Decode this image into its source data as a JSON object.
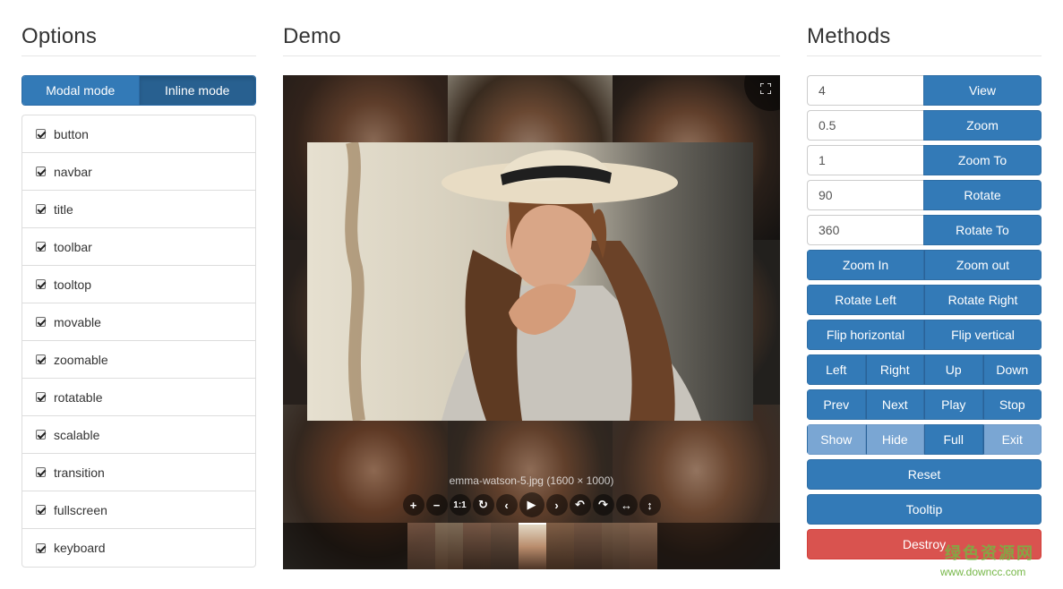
{
  "options": {
    "title": "Options",
    "modes": [
      "Modal mode",
      "Inline mode"
    ],
    "active_mode": "Inline mode",
    "items": [
      "button",
      "navbar",
      "title",
      "toolbar",
      "tooltop",
      "movable",
      "zoomable",
      "rotatable",
      "scalable",
      "transition",
      "fullscreen",
      "keyboard"
    ]
  },
  "demo": {
    "title": "Demo",
    "image_title": "emma-watson-5.jpg (1600 × 1000)",
    "toolbar_icons": [
      "zoom-in-icon",
      "zoom-out-icon",
      "one-to-one-icon",
      "reset-icon",
      "prev-icon",
      "play-icon",
      "next-icon",
      "rotate-left-icon",
      "rotate-right-icon",
      "flip-horizontal-icon",
      "flip-vertical-icon"
    ],
    "one_to_one": "1:1",
    "thumbnail_count": 9,
    "active_thumbnail": 5
  },
  "methods": {
    "title": "Methods",
    "inputs": [
      {
        "value": "4",
        "button": "View"
      },
      {
        "value": "0.5",
        "button": "Zoom"
      },
      {
        "value": "1",
        "button": "Zoom To"
      },
      {
        "value": "90",
        "button": "Rotate"
      },
      {
        "value": "360",
        "button": "Rotate To"
      }
    ],
    "zoom": [
      "Zoom In",
      "Zoom out"
    ],
    "rotate": [
      "Rotate Left",
      "Rotate Right"
    ],
    "flip": [
      "Flip horizontal",
      "Flip vertical"
    ],
    "move": [
      "Left",
      "Right",
      "Up",
      "Down"
    ],
    "play": [
      "Prev",
      "Next",
      "Play",
      "Stop"
    ],
    "show": [
      "Show",
      "Hide",
      "Full",
      "Exit"
    ],
    "reset": "Reset",
    "tooltip": "Tooltip",
    "destroy": "Destroy"
  },
  "watermark": {
    "site_cn": "绿色资源网",
    "url": "www.downcc.com"
  },
  "colors": {
    "primary": "#337ab7",
    "primary_active": "#286090",
    "primary_light": "#7aa6d3",
    "danger": "#d9534f"
  }
}
